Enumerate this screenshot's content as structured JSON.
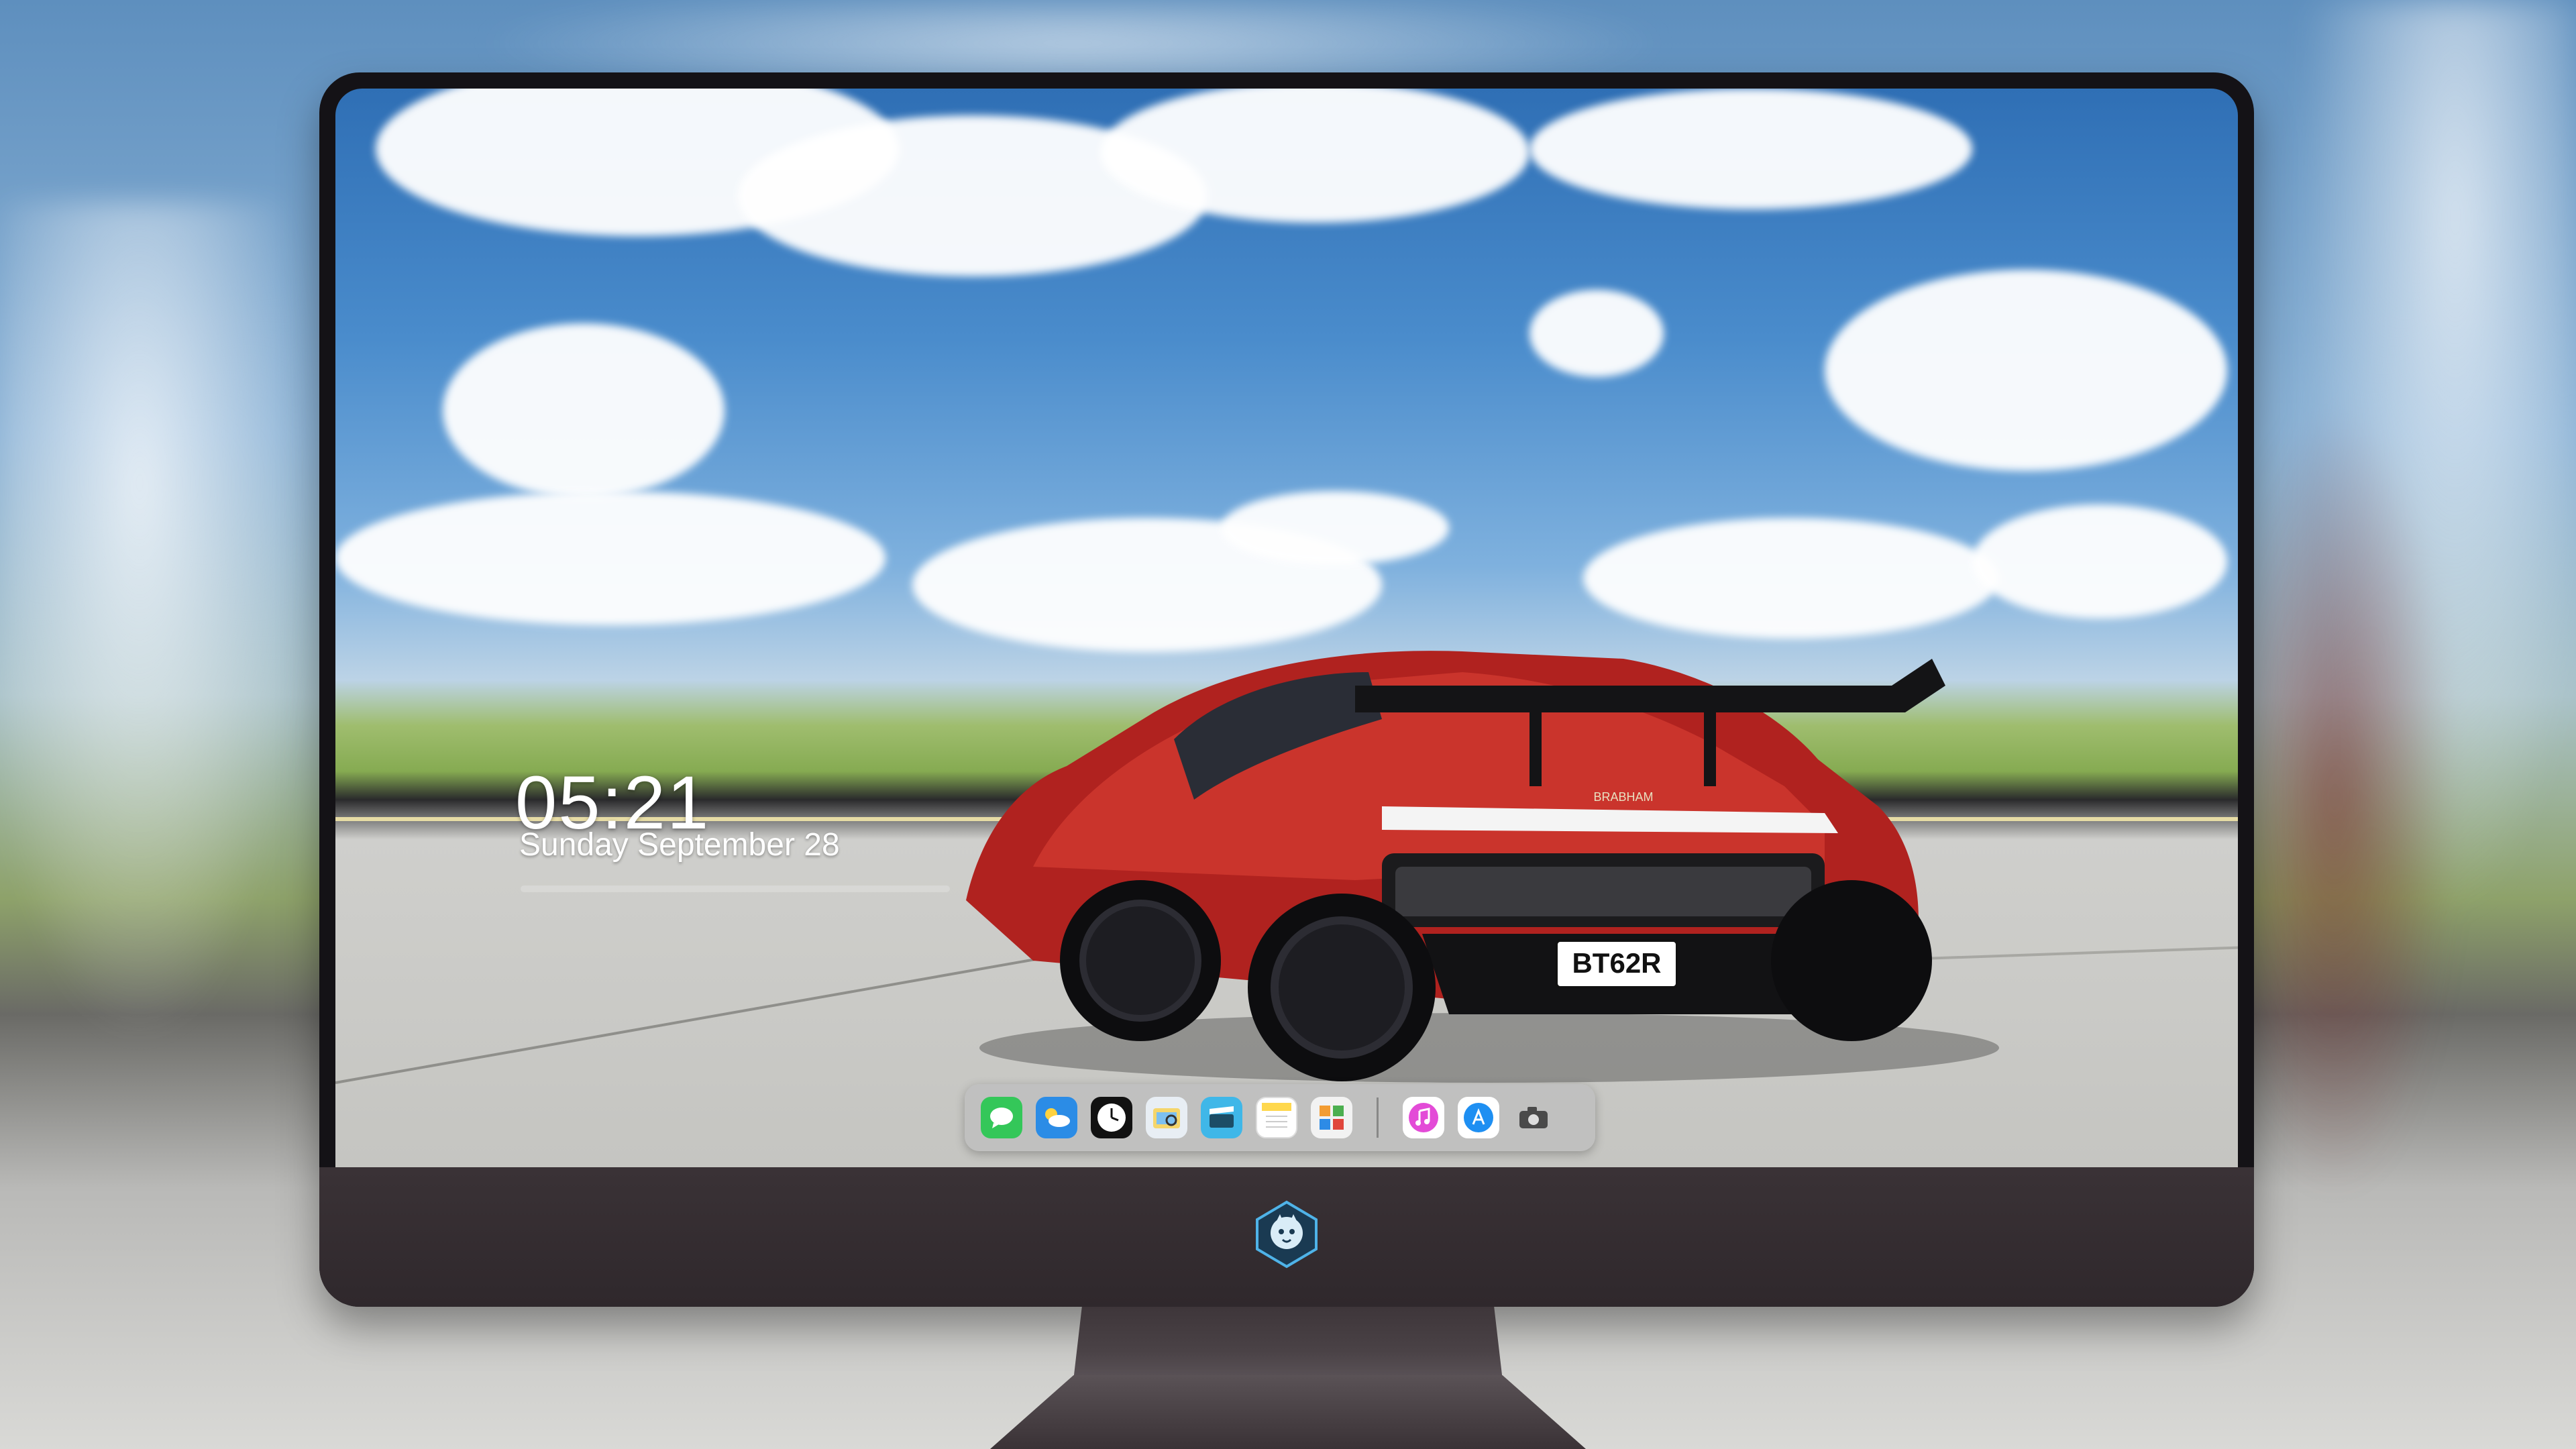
{
  "lock_screen": {
    "time": "05:21",
    "date": "Sunday September  28"
  },
  "wallpaper": {
    "plate_text": "BT62R",
    "badge_text": "BRABHAM"
  },
  "dock": {
    "apps": [
      {
        "name": "messages-icon",
        "glyph": "💬",
        "color": "#34c759"
      },
      {
        "name": "weather-icon",
        "glyph": "☁",
        "color": "#2b8ce6"
      },
      {
        "name": "clock-icon",
        "glyph": "🕓",
        "color": "#ffffff"
      },
      {
        "name": "preview-icon",
        "glyph": "🔍",
        "color": "#f5d66b"
      },
      {
        "name": "clips-icon",
        "glyph": "🎬",
        "color": "#3fb7e8"
      },
      {
        "name": "notes-icon",
        "glyph": "≡",
        "color": "#ffe680"
      },
      {
        "name": "photos-icon",
        "glyph": "▦",
        "color": "#f2f2f2"
      },
      {
        "name": "music-icon",
        "glyph": "♫",
        "color": "#e34bd7"
      },
      {
        "name": "app-store-icon",
        "glyph": "A",
        "color": "#1e8ff2"
      },
      {
        "name": "camera-icon",
        "glyph": "◙",
        "color": "#c8c8c8"
      }
    ]
  }
}
